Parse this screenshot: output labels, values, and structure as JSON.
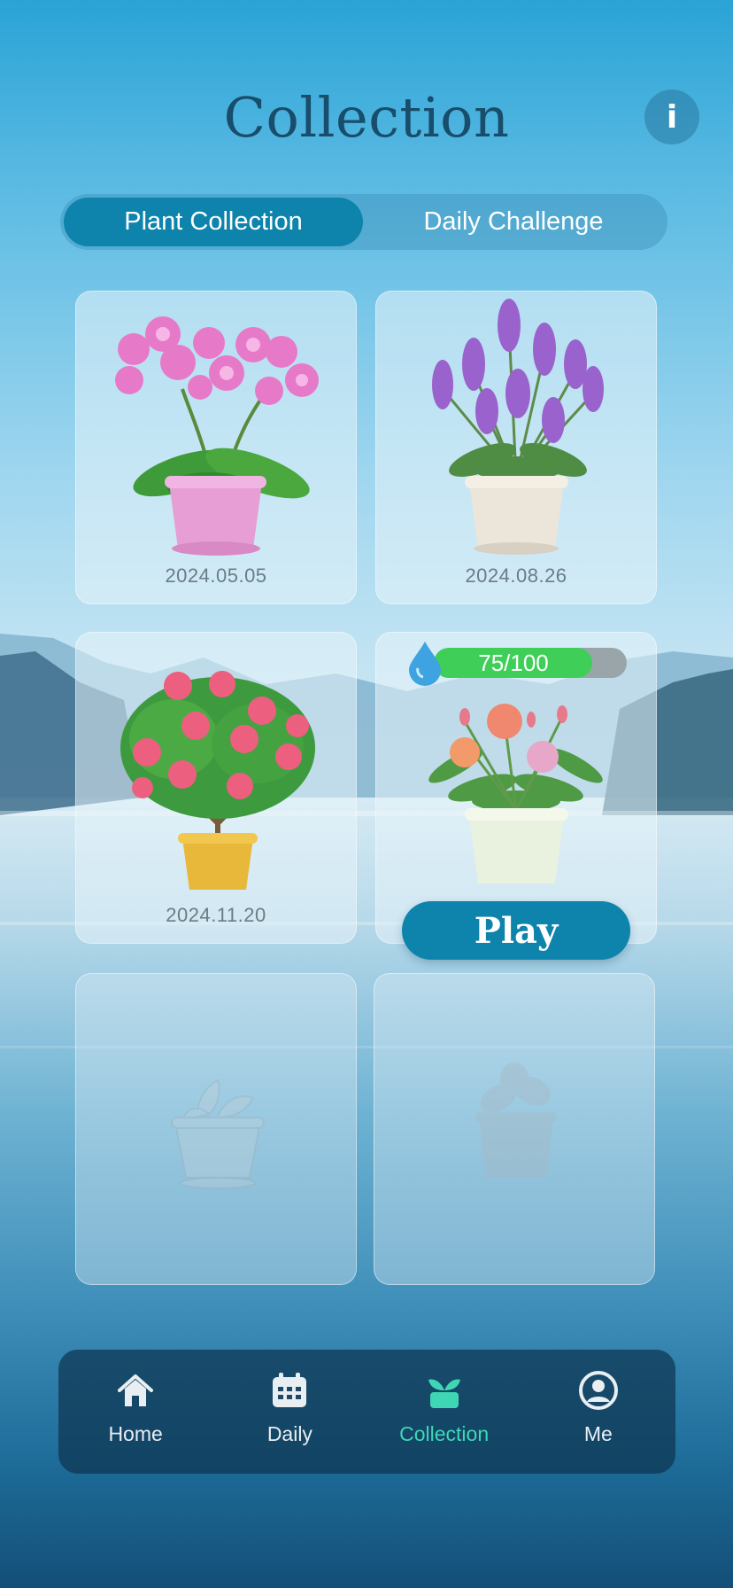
{
  "header": {
    "title": "Collection",
    "info_label": "i"
  },
  "tabs": [
    {
      "label": "Plant Collection",
      "active": true
    },
    {
      "label": "Daily Challenge",
      "active": false
    }
  ],
  "cards": [
    {
      "plant": "orchid",
      "date": "2024.05.05"
    },
    {
      "plant": "lavender",
      "date": "2024.08.26"
    },
    {
      "plant": "camellia",
      "date": "2024.11.20"
    },
    {
      "plant": "carnation",
      "water_progress": "75/100",
      "water_value": 75,
      "water_max": 100,
      "play_label": "Play"
    },
    {
      "plant": "locked-plant",
      "state": "locked"
    },
    {
      "plant": "locked-plant",
      "state": "locked"
    }
  ],
  "nav": [
    {
      "label": "Home",
      "icon": "home-icon"
    },
    {
      "label": "Daily",
      "icon": "calendar-icon"
    },
    {
      "label": "Collection",
      "icon": "sprout-pot-icon",
      "active": true
    },
    {
      "label": "Me",
      "icon": "user-icon"
    }
  ],
  "colors": {
    "accent": "#0e84ac",
    "title": "#184d6b",
    "active_nav": "#3fd6b6",
    "progress": "#3fcf58"
  }
}
